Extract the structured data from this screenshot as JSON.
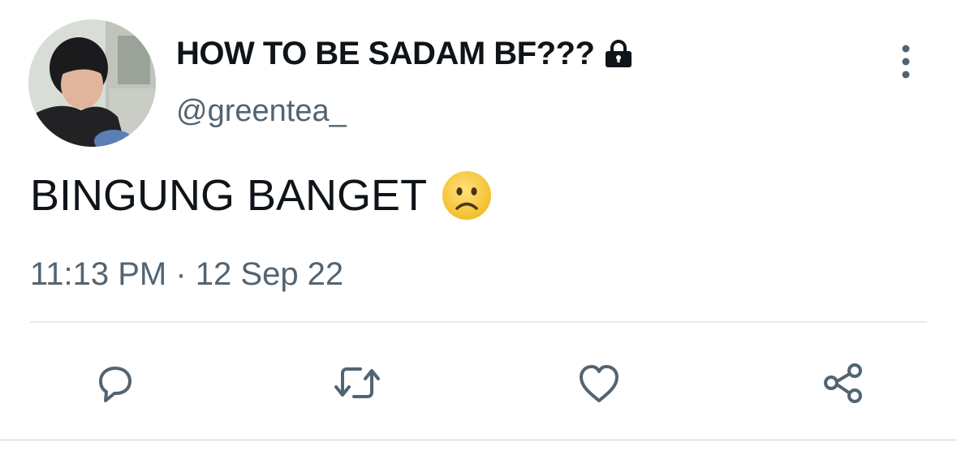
{
  "author": {
    "display_name": "HOW TO BE SADAM BF???",
    "handle": "@greentea_",
    "protected_icon": "lock-icon"
  },
  "tweet": {
    "text": "BINGUNG BANGET",
    "emoji": "frowning-face-emoji",
    "timestamp": "11:13 PM · 12 Sep 22"
  },
  "actions": [
    {
      "name": "reply",
      "icon": "reply-icon"
    },
    {
      "name": "retweet",
      "icon": "retweet-icon"
    },
    {
      "name": "like",
      "icon": "heart-icon"
    },
    {
      "name": "share",
      "icon": "share-icon"
    }
  ],
  "colors": {
    "text_primary": "#0f1419",
    "text_secondary": "#536471",
    "icon": "#536471",
    "divider": "#e6ecf0"
  }
}
